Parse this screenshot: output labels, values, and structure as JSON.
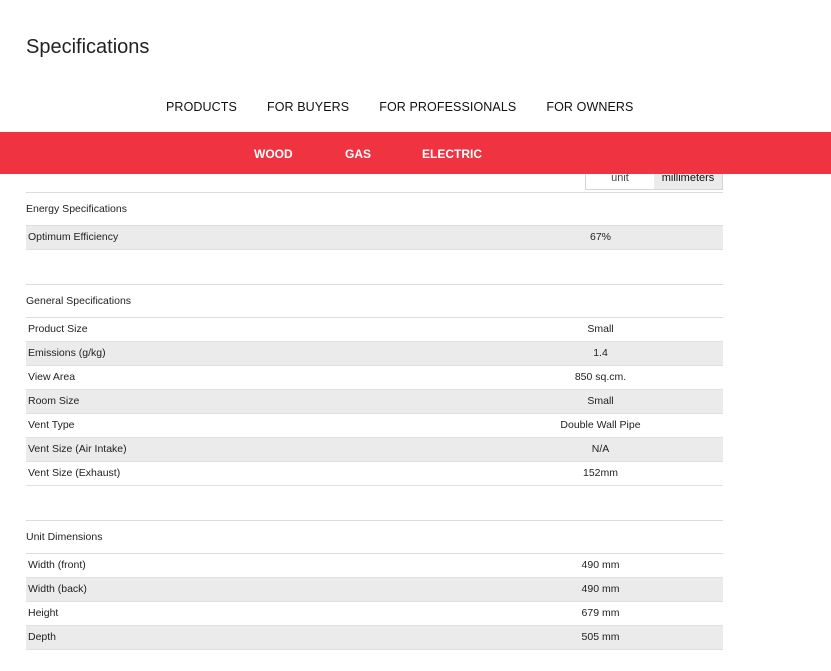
{
  "page": {
    "title": "Specifications"
  },
  "main_nav": [
    "PRODUCTS",
    "FOR BUYERS",
    "FOR PROFESSIONALS",
    "FOR OWNERS"
  ],
  "sub_nav": [
    "WOOD",
    "GAS",
    "ELECTRIC"
  ],
  "unit_toggle": {
    "unit_label": "unit",
    "selected_label": "millimeters"
  },
  "colors": {
    "accent": "#ef3340",
    "row_shade": "#ebebeb"
  },
  "sections": [
    {
      "title": "Energy Specifications",
      "rows": [
        {
          "label": "Optimum Efficiency",
          "value": "67%"
        }
      ]
    },
    {
      "title": "General Specifications",
      "rows": [
        {
          "label": "Product Size",
          "value": "Small"
        },
        {
          "label": "Emissions (g/kg)",
          "value": "1.4"
        },
        {
          "label": "View Area",
          "value": "850 sq.cm."
        },
        {
          "label": "Room Size",
          "value": "Small"
        },
        {
          "label": "Vent Type",
          "value": "Double Wall Pipe"
        },
        {
          "label": "Vent Size (Air Intake)",
          "value": "N/A"
        },
        {
          "label": "Vent Size (Exhaust)",
          "value": "152mm"
        }
      ]
    },
    {
      "title": "Unit Dimensions",
      "rows": [
        {
          "label": "Width (front)",
          "value": "490 mm"
        },
        {
          "label": "Width (back)",
          "value": "490 mm"
        },
        {
          "label": "Height",
          "value": "679 mm"
        },
        {
          "label": "Depth",
          "value": "505 mm"
        }
      ]
    }
  ]
}
